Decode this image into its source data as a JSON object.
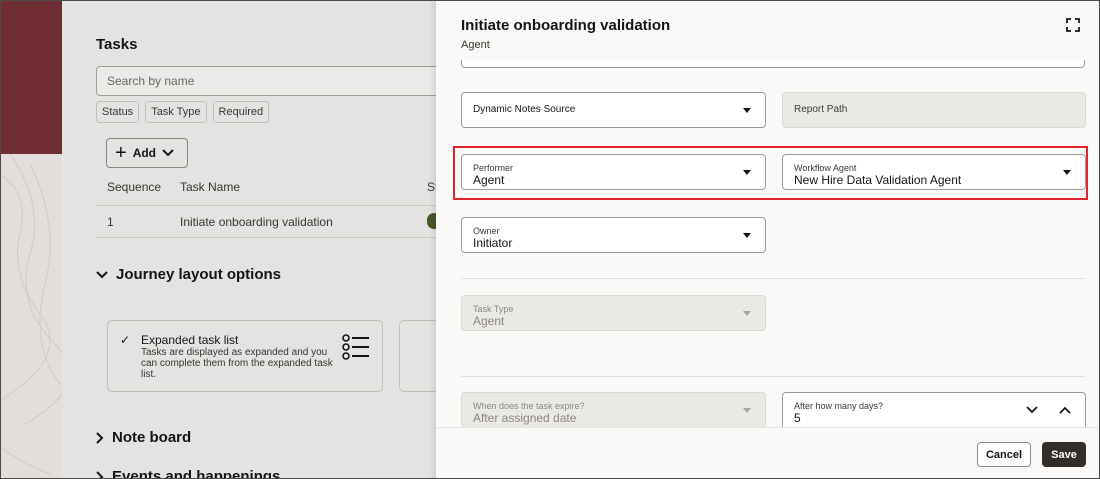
{
  "background": {
    "tasks_title": "Tasks",
    "search_placeholder": "Search by name",
    "filters": [
      "Status",
      "Task Type",
      "Required"
    ],
    "add_label": "Add",
    "columns": {
      "sequence": "Sequence",
      "task_name": "Task Name",
      "status_partial": "St"
    },
    "row": {
      "sequence": "1",
      "task_name": "Initiate onboarding validation"
    },
    "journey_layout": "Journey layout options",
    "card": {
      "title": "Expanded task list",
      "description": "Tasks are displayed as expanded and you can complete them from the expanded task list."
    },
    "note_board": "Note board",
    "events": "Events and happenings"
  },
  "drawer": {
    "title": "Initiate onboarding validation",
    "subtitle": "Agent",
    "dynamic_notes_source": "Dynamic Notes Source",
    "report_path": "Report Path",
    "performer": {
      "label": "Performer",
      "value": "Agent"
    },
    "workflow_agent": {
      "label": "Workflow Agent",
      "value": "New Hire Data Validation Agent"
    },
    "owner": {
      "label": "Owner",
      "value": "Initiator"
    },
    "task_type": {
      "label": "Task Type",
      "value": "Agent"
    },
    "expire": {
      "label": "When does the task expire?",
      "value": "After assigned date"
    },
    "days": {
      "label": "After how many days?",
      "value": "5"
    },
    "cancel_label": "Cancel",
    "save_label": "Save"
  },
  "colors": {
    "highlight": "#e0232e",
    "brand": "#6f2e33",
    "primary_button": "#312d2a"
  }
}
